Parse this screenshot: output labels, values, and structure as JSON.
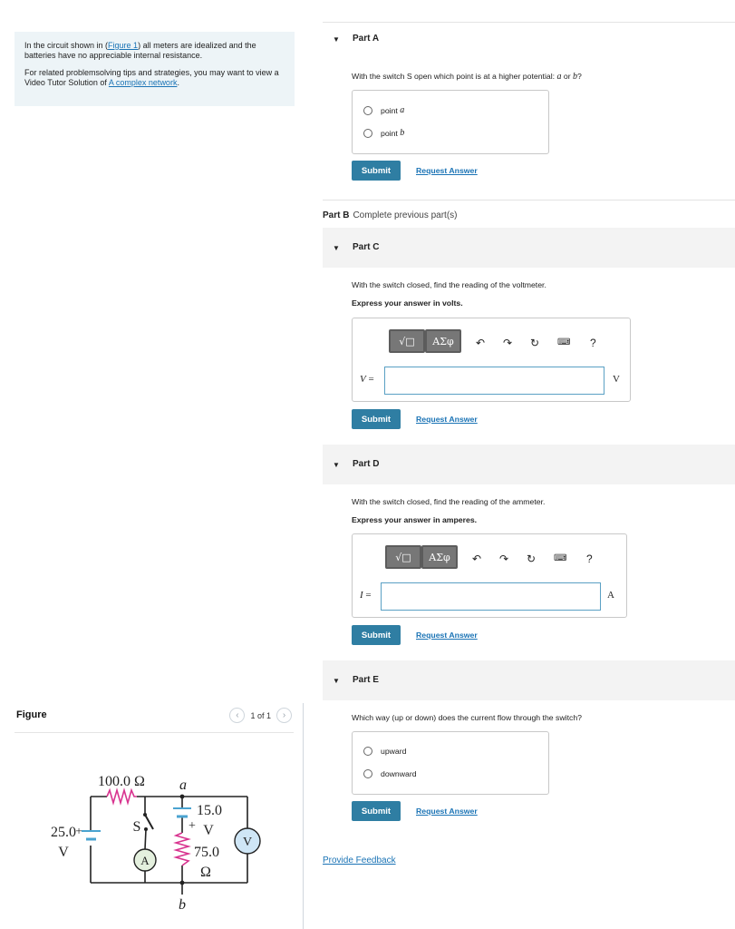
{
  "intro": {
    "line1_pre": "In the circuit shown in (",
    "line1_link": "Figure 1",
    "line1_post": ") all meters are idealized and the batteries have no appreciable internal resistance.",
    "line2_pre": "For related problemsolving tips and strategies, you may want to view a Video Tutor Solution of ",
    "line2_link": "A complex network",
    "line2_post": "."
  },
  "figure": {
    "title": "Figure",
    "pager": "1 of 1",
    "prev_icon": "chevron-left-icon",
    "next_icon": "chevron-right-icon",
    "labels": {
      "r_top": "100.0 Ω",
      "node_a": "a",
      "node_b": "b",
      "battery_left_value": "25.0",
      "battery_left_unit": "V",
      "battery_mid_value": "15.0",
      "battery_mid_unit": "V",
      "plus_left": "+",
      "plus_mid": "+",
      "switch": "S",
      "ammeter": "A",
      "voltmeter": "V",
      "r_mid_value": "75.0",
      "r_mid_unit": "Ω"
    }
  },
  "parts": {
    "a": {
      "label": "Part A",
      "question_pre": "With the switch S open which point is at a higher potential: ",
      "var_a": "a",
      "or": " or ",
      "var_b": "b",
      "question_post": "?",
      "choices": [
        {
          "pre": "point ",
          "var": "a"
        },
        {
          "pre": "point ",
          "var": "b"
        }
      ]
    },
    "b": {
      "label": "Part B",
      "status": "Complete previous part(s)"
    },
    "c": {
      "label": "Part C",
      "question": "With the switch closed, find the reading of the voltmeter.",
      "instruction": "Express your answer in volts.",
      "variable": "V",
      "equals": " =",
      "unit": "V",
      "value": ""
    },
    "d": {
      "label": "Part D",
      "question": "With the switch closed, find the reading of the ammeter.",
      "instruction": "Express your answer in amperes.",
      "variable": "I",
      "equals": " =",
      "unit": "A",
      "value": ""
    },
    "e": {
      "label": "Part E",
      "question": "Which way (up or down) does the current flow through the switch?",
      "choices": [
        "upward",
        "downward"
      ]
    }
  },
  "toolbar": {
    "templates_label": "√□",
    "greek_label": "ΑΣφ",
    "undo_icon": "undo-icon",
    "redo_icon": "redo-icon",
    "reset_icon": "reset-icon",
    "keyboard_icon": "keyboard-icon",
    "help_label": "?"
  },
  "actions": {
    "submit": "Submit",
    "request": "Request Answer",
    "feedback": "Provide Feedback"
  },
  "colors": {
    "accent": "#2f7ea3",
    "link": "#1a73b5",
    "intro_bg": "#edf4f7",
    "resistor": "#d8338f"
  }
}
